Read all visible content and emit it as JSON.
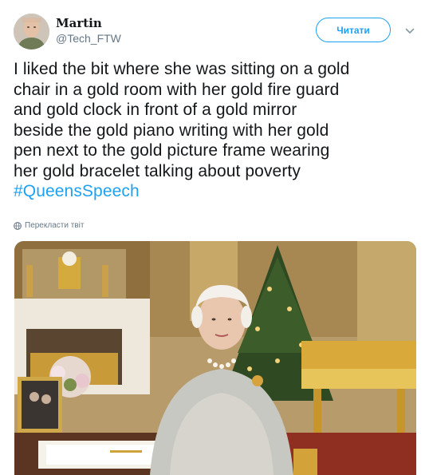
{
  "user": {
    "display_name": "Martin",
    "handle": "@Tech_FTW"
  },
  "follow_button_label": "Читати",
  "tweet": {
    "lines": [
      "I liked the bit where she was sitting on a gold",
      "chair in a gold room with her gold fire guard",
      "and gold clock in front of a gold mirror",
      "beside the gold piano writing with her gold",
      "pen next to the gold picture frame wearing",
      "her gold bracelet talking about poverty"
    ],
    "hashtag": "#QueensSpeech"
  },
  "translate_label": "Перекласти твіт",
  "colors": {
    "accent": "#1da1f2",
    "text": "#14171a",
    "secondary": "#657786"
  },
  "icons": {
    "caret": "chevron-down-icon",
    "translate": "globe-icon"
  }
}
